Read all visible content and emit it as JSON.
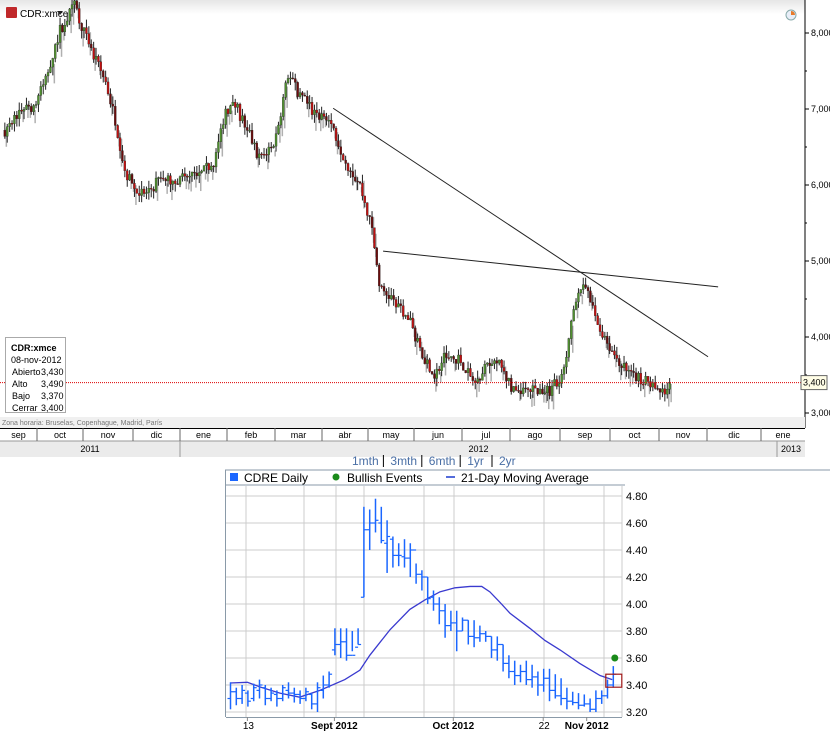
{
  "chart_data": [
    {
      "type": "candlestick",
      "title": "CDR:xmce",
      "ylim": [
        2850,
        8450
      ],
      "y_ticks": [
        "8,000",
        "7,000",
        "6,000",
        "5,000",
        "4,000",
        "3,000"
      ],
      "y_tick_values": [
        8000,
        7000,
        6000,
        5000,
        4000,
        3000
      ],
      "x_months": [
        "sep",
        "oct",
        "nov",
        "dic",
        "ene",
        "feb",
        "mar",
        "abr",
        "may",
        "jun",
        "jul",
        "ago",
        "sep",
        "oct",
        "nov",
        "dic",
        "ene"
      ],
      "x_years": [
        "2011",
        "2012",
        "2013"
      ],
      "timezone_note": "Zona horaria: Bruselas, Copenhague, Madrid, París",
      "last_price_label": "3,400",
      "last_price": 3400,
      "ohlc_box": {
        "symbol": "CDR:xmce",
        "date": "08-nov-2012",
        "rows": [
          {
            "label": "Abierto",
            "value": "3,430"
          },
          {
            "label": "Alto",
            "value": "3,490"
          },
          {
            "label": "Bajo",
            "value": "3,370"
          },
          {
            "label": "Cerrar",
            "value": "3,400"
          }
        ]
      },
      "price_path_note_units": "month offset from 1-sep-2011, price",
      "price_path": [
        [
          0.33,
          6720
        ],
        [
          0.65,
          6990
        ],
        [
          0.96,
          7050
        ],
        [
          1.17,
          7380
        ],
        [
          1.48,
          8040
        ],
        [
          1.79,
          8370
        ],
        [
          2.1,
          7780
        ],
        [
          2.42,
          7380
        ],
        [
          2.63,
          6860
        ],
        [
          2.83,
          6200
        ],
        [
          3.04,
          5930
        ],
        [
          3.25,
          5870
        ],
        [
          3.56,
          6070
        ],
        [
          3.98,
          6070
        ],
        [
          4.4,
          6130
        ],
        [
          4.71,
          6330
        ],
        [
          4.92,
          6990
        ],
        [
          5.13,
          7050
        ],
        [
          5.33,
          6790
        ],
        [
          5.65,
          6330
        ],
        [
          5.96,
          6590
        ],
        [
          6.23,
          7450
        ],
        [
          6.48,
          7180
        ],
        [
          6.79,
          6920
        ],
        [
          7.1,
          6860
        ],
        [
          7.42,
          6330
        ],
        [
          7.73,
          6000
        ],
        [
          7.98,
          5410
        ],
        [
          8.15,
          4620
        ],
        [
          8.46,
          4490
        ],
        [
          8.77,
          4220
        ],
        [
          8.98,
          3830
        ],
        [
          9.29,
          3500
        ],
        [
          9.5,
          3760
        ],
        [
          9.81,
          3700
        ],
        [
          10.13,
          3370
        ],
        [
          10.44,
          3700
        ],
        [
          10.65,
          3630
        ],
        [
          10.96,
          3240
        ],
        [
          11.27,
          3300
        ],
        [
          11.69,
          3300
        ],
        [
          12.0,
          3570
        ],
        [
          12.21,
          4490
        ],
        [
          12.31,
          4690
        ],
        [
          12.52,
          4490
        ],
        [
          12.73,
          4090
        ],
        [
          13.04,
          3760
        ],
        [
          13.35,
          3500
        ],
        [
          13.67,
          3430
        ],
        [
          13.98,
          3240
        ],
        [
          14.23,
          3400
        ]
      ],
      "trendlines": [
        {
          "from": [
            7.17,
            7010
          ],
          "to": [
            14.98,
            3740
          ]
        },
        {
          "from": [
            8.21,
            5130
          ],
          "to": [
            15.19,
            4660
          ]
        }
      ],
      "colors": {
        "up": "#4f8f2f",
        "down": "#c01010",
        "shadow": "#b0b0b0"
      }
    },
    {
      "type": "ohlc",
      "range_links": [
        "1mth",
        "3mth",
        "6mth",
        "1yr",
        "2yr"
      ],
      "legend": [
        "CDRE Daily",
        "Bullish Events",
        "21-Day Moving Average"
      ],
      "ylim": [
        3.17,
        4.88
      ],
      "y_ticks": [
        "4.80",
        "4.60",
        "4.40",
        "4.20",
        "4.00",
        "3.80",
        "3.60",
        "3.40",
        "3.20"
      ],
      "y_tick_values": [
        4.8,
        4.6,
        4.4,
        4.2,
        4.0,
        3.8,
        3.6,
        3.4,
        3.2
      ],
      "x_labels": [
        {
          "day": 3,
          "label": "13",
          "bold": false
        },
        {
          "day": 18,
          "label": "Sept 2012",
          "bold": true
        },
        {
          "day": 38.5,
          "label": "Oct 2012",
          "bold": true
        },
        {
          "day": 54,
          "label": "22",
          "bold": false
        },
        {
          "day": 61.5,
          "label": "Nov 2012",
          "bold": true
        }
      ],
      "bars_hloc": [
        [
          3.42,
          3.22,
          3.3,
          3.35
        ],
        [
          3.38,
          3.25,
          3.35,
          3.3
        ],
        [
          3.4,
          3.26,
          3.3,
          3.36
        ],
        [
          3.36,
          3.24,
          3.34,
          3.28
        ],
        [
          3.41,
          3.28,
          3.3,
          3.38
        ],
        [
          3.44,
          3.3,
          3.36,
          3.4
        ],
        [
          3.4,
          3.25,
          3.38,
          3.3
        ],
        [
          3.38,
          3.28,
          3.3,
          3.34
        ],
        [
          3.36,
          3.24,
          3.33,
          3.3
        ],
        [
          3.4,
          3.28,
          3.3,
          3.38
        ],
        [
          3.42,
          3.3,
          3.36,
          3.34
        ],
        [
          3.38,
          3.27,
          3.34,
          3.33
        ],
        [
          3.36,
          3.26,
          3.33,
          3.3
        ],
        [
          3.38,
          3.28,
          3.3,
          3.35
        ],
        [
          3.34,
          3.22,
          3.33,
          3.26
        ],
        [
          3.42,
          3.2,
          3.26,
          3.38
        ],
        [
          3.47,
          3.3,
          3.36,
          3.4
        ],
        [
          3.5,
          3.38,
          3.4,
          3.48
        ],
        [
          3.82,
          3.62,
          3.66,
          3.7
        ],
        [
          3.82,
          3.6,
          3.7,
          3.72
        ],
        [
          3.82,
          3.58,
          3.72,
          3.62
        ],
        [
          3.8,
          3.65,
          3.62,
          3.62
        ],
        [
          3.82,
          3.7,
          3.68,
          3.7
        ],
        [
          4.72,
          4.05,
          4.05,
          4.55
        ],
        [
          4.7,
          4.4,
          4.55,
          4.6
        ],
        [
          4.78,
          4.53,
          4.6,
          4.62
        ],
        [
          4.72,
          4.45,
          4.6,
          4.47
        ],
        [
          4.62,
          4.23,
          4.45,
          4.5
        ],
        [
          4.5,
          4.27,
          4.48,
          4.36
        ],
        [
          4.45,
          4.28,
          4.36,
          4.36
        ],
        [
          4.48,
          4.27,
          4.35,
          4.34
        ],
        [
          4.45,
          4.2,
          4.34,
          4.4
        ],
        [
          4.3,
          4.15,
          4.4,
          4.22
        ],
        [
          4.25,
          4.1,
          4.22,
          4.2
        ],
        [
          4.2,
          4.0,
          4.2,
          4.04
        ],
        [
          4.1,
          3.95,
          4.05,
          4.0
        ],
        [
          4.05,
          3.85,
          4.0,
          3.95
        ],
        [
          4.0,
          3.75,
          3.95,
          3.84
        ],
        [
          3.95,
          3.8,
          3.84,
          3.86
        ],
        [
          3.95,
          3.65,
          3.86,
          3.8
        ],
        [
          3.9,
          3.8,
          3.8,
          3.88
        ],
        [
          3.88,
          3.7,
          3.88,
          3.76
        ],
        [
          3.88,
          3.68,
          3.76,
          3.75
        ],
        [
          3.84,
          3.72,
          3.75,
          3.78
        ],
        [
          3.8,
          3.72,
          3.78,
          3.76
        ],
        [
          3.76,
          3.6,
          3.76,
          3.66
        ],
        [
          3.76,
          3.58,
          3.66,
          3.7
        ],
        [
          3.7,
          3.5,
          3.7,
          3.56
        ],
        [
          3.62,
          3.45,
          3.56,
          3.5
        ],
        [
          3.58,
          3.4,
          3.5,
          3.47
        ],
        [
          3.55,
          3.42,
          3.47,
          3.5
        ],
        [
          3.58,
          3.4,
          3.5,
          3.44
        ],
        [
          3.55,
          3.38,
          3.44,
          3.46
        ],
        [
          3.5,
          3.32,
          3.46,
          3.4
        ],
        [
          3.52,
          3.35,
          3.4,
          3.45
        ],
        [
          3.52,
          3.28,
          3.45,
          3.36
        ],
        [
          3.48,
          3.3,
          3.36,
          3.32
        ],
        [
          3.45,
          3.25,
          3.32,
          3.3
        ],
        [
          3.38,
          3.22,
          3.3,
          3.28
        ],
        [
          3.35,
          3.25,
          3.28,
          3.27
        ],
        [
          3.34,
          3.22,
          3.27,
          3.25
        ],
        [
          3.33,
          3.24,
          3.25,
          3.26
        ],
        [
          3.3,
          3.2,
          3.26,
          3.22
        ],
        [
          3.36,
          3.2,
          3.22,
          3.3
        ],
        [
          3.36,
          3.26,
          3.3,
          3.32
        ],
        [
          3.44,
          3.3,
          3.32,
          3.4
        ],
        [
          3.54,
          3.38,
          3.4,
          3.48
        ]
      ],
      "moving_average_21": [
        [
          0,
          3.415
        ],
        [
          3,
          3.42
        ],
        [
          5.2,
          3.385
        ],
        [
          8.6,
          3.34
        ],
        [
          12,
          3.31
        ],
        [
          15.5,
          3.36
        ],
        [
          19.8,
          3.44
        ],
        [
          22.4,
          3.51
        ],
        [
          24.1,
          3.62
        ],
        [
          27.6,
          3.81
        ],
        [
          31,
          3.96
        ],
        [
          33.6,
          4.03
        ],
        [
          36.2,
          4.09
        ],
        [
          38.8,
          4.12
        ],
        [
          41.4,
          4.13
        ],
        [
          43.4,
          4.13
        ],
        [
          44.8,
          4.09
        ],
        [
          46.6,
          4.01
        ],
        [
          48.3,
          3.93
        ],
        [
          51.7,
          3.82
        ],
        [
          54.3,
          3.73
        ],
        [
          56.9,
          3.66
        ],
        [
          60.3,
          3.56
        ],
        [
          63.8,
          3.47
        ],
        [
          65.9,
          3.44
        ]
      ],
      "bullish_events": [
        {
          "day": 66,
          "value": 3.6
        }
      ],
      "colors": {
        "bars": "#1a66ff",
        "ma": "#3a3acf",
        "event": "#1a8a1a",
        "highlight": "#a01818"
      }
    }
  ]
}
